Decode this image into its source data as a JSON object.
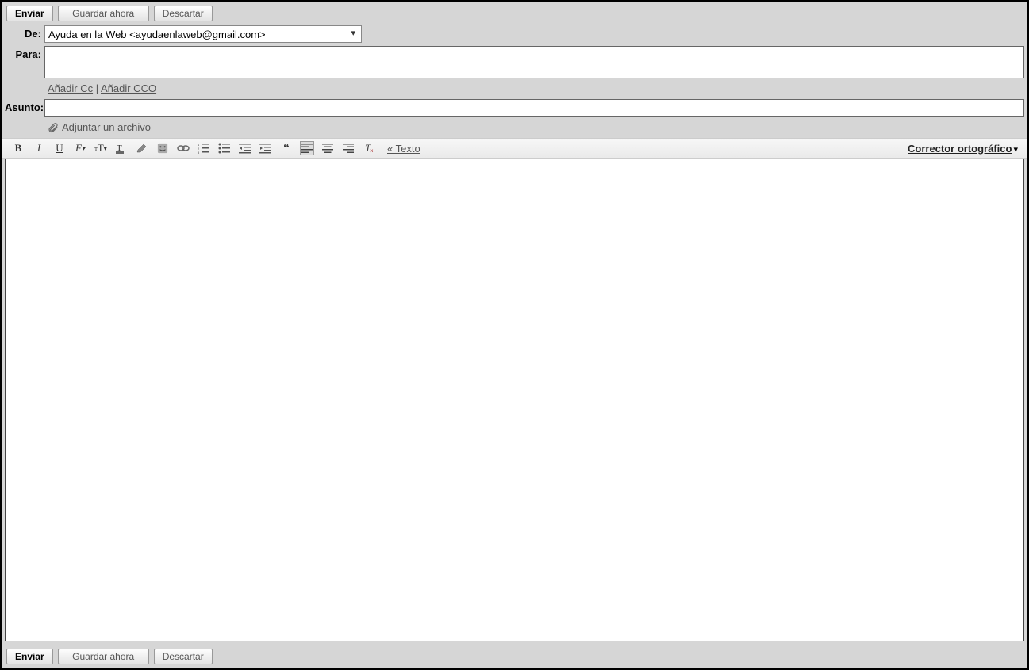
{
  "buttons": {
    "send": "Enviar",
    "save": "Guardar ahora",
    "discard": "Descartar"
  },
  "labels": {
    "from": "De:",
    "to": "Para:",
    "subject": "Asunto:"
  },
  "from_value": "Ayuda en la Web <ayudaenlaweb@gmail.com>",
  "to_value": "",
  "subject_value": "",
  "cc": {
    "add_cc": "Añadir Cc",
    "add_bcc": "Añadir CCO"
  },
  "attach": "Adjuntar un archivo",
  "toolbar": {
    "plain_text": "«  Texto",
    "spellcheck": "Corrector ortográfico"
  },
  "body_value": ""
}
